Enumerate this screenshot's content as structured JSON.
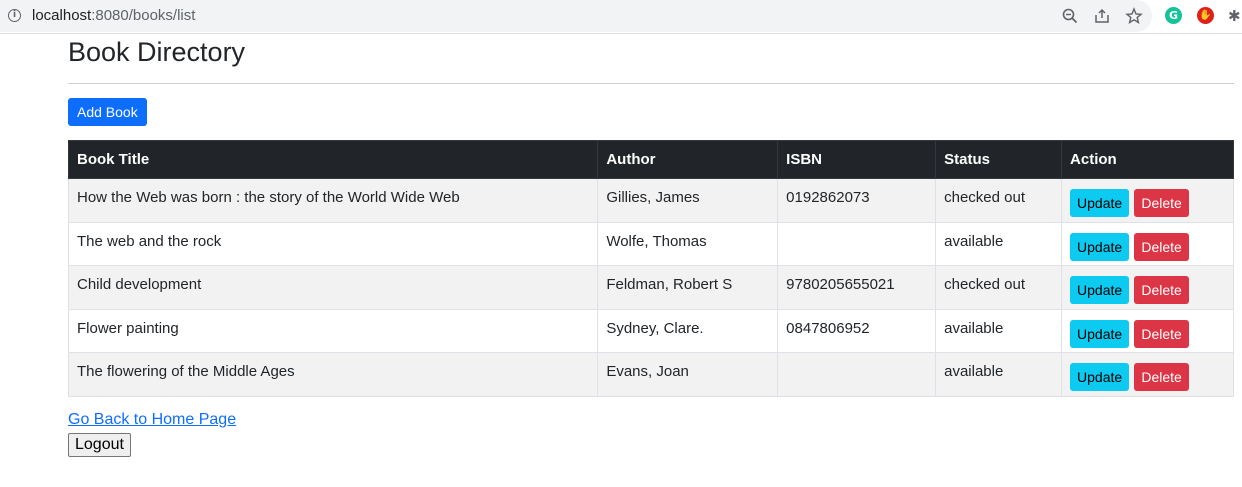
{
  "browser": {
    "url_host": "localhost",
    "url_rest": ":8080/books/list",
    "icons": [
      "info-icon",
      "zoom-icon",
      "share-icon",
      "star-icon",
      "grammarly-extension-icon",
      "red-extension-icon",
      "puzzle-extension-icon"
    ]
  },
  "page": {
    "title": "Book Directory",
    "add_button": "Add Book",
    "home_link": "Go Back to Home Page",
    "logout_button": "Logout"
  },
  "table": {
    "headers": [
      "Book Title",
      "Author",
      "ISBN",
      "Status",
      "Action"
    ],
    "rows": [
      {
        "title": "How the Web was born : the story of the World Wide Web",
        "author": "Gillies, James",
        "isbn": "0192862073",
        "status": "checked out"
      },
      {
        "title": "The web and the rock",
        "author": "Wolfe, Thomas",
        "isbn": "",
        "status": "available"
      },
      {
        "title": "Child development",
        "author": "Feldman, Robert S",
        "isbn": "9780205655021",
        "status": "checked out"
      },
      {
        "title": "Flower painting",
        "author": "Sydney, Clare.",
        "isbn": "0847806952",
        "status": "available"
      },
      {
        "title": "The flowering of the Middle Ages",
        "author": "Evans, Joan",
        "isbn": "",
        "status": "available"
      }
    ],
    "update_label": "Update",
    "delete_label": "Delete"
  },
  "colors": {
    "primary": "#0d6efd",
    "info": "#0dcaf0",
    "danger": "#dc3545",
    "header_dark": "#212529"
  }
}
